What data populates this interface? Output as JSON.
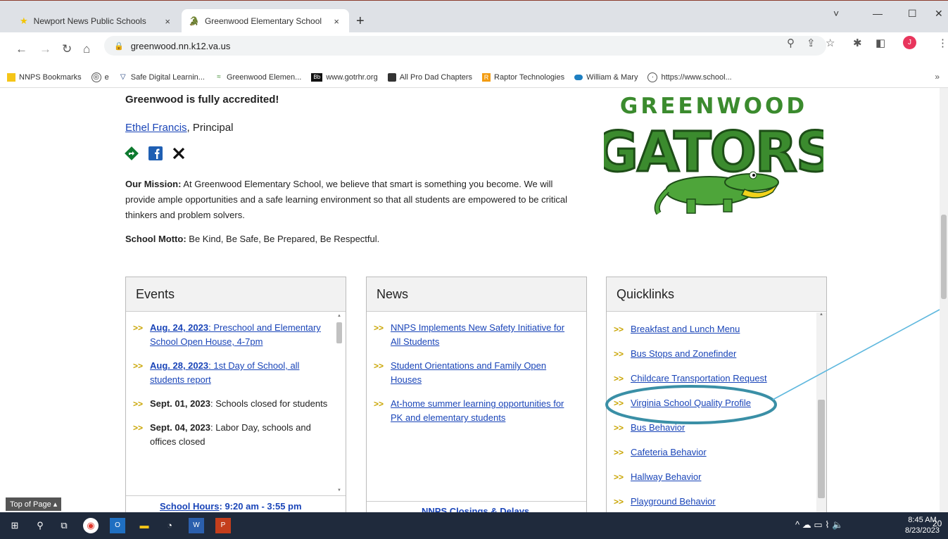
{
  "browser": {
    "tabs": [
      {
        "title": "Newport News Public Schools",
        "close": "×"
      },
      {
        "title": "Greenwood Elementary School",
        "close": "×"
      }
    ],
    "new_tab": "+",
    "window_controls": {
      "dropdown": "˅",
      "minimize": "—",
      "maximize": "☐",
      "close": "✕"
    },
    "url": "greenwood.nn.k12.va.us",
    "profile_initial": "J",
    "bookmarks": [
      {
        "label": "NNPS Bookmarks",
        "icon": "folder-icon"
      },
      {
        "label": "e",
        "icon": "edge-icon"
      },
      {
        "label": "Safe Digital Learnin...",
        "icon": "shield-icon"
      },
      {
        "label": "Greenwood Elemen...",
        "icon": "gator-icon"
      },
      {
        "label": "www.gotrhr.org",
        "icon": "bb-icon"
      },
      {
        "label": "All Pro Dad Chapters",
        "icon": "app-icon"
      },
      {
        "label": "Raptor Technologies",
        "icon": "raptor-icon"
      },
      {
        "label": "William & Mary",
        "icon": "wm-icon"
      },
      {
        "label": "https://www.school...",
        "icon": "globe-icon"
      }
    ],
    "bookmarks_more": "»"
  },
  "page": {
    "accredited": "Greenwood is fully accredited!",
    "principal_name": "Ethel Francis",
    "principal_title": ", Principal",
    "mission_label": "Our Mission:",
    "mission_text": " At Greenwood Elementary School, we believe that smart is something you become. We will provide ample opportunities and a safe learning environment so that all students are empowered to be critical thinkers and problem solvers.",
    "motto_label": "School Motto:",
    "motto_text": " Be Kind, Be Safe, Be Prepared, Be Respectful.",
    "logo_top": "GREENWOOD",
    "logo_main": "GATORS",
    "events": {
      "title": "Events",
      "items": [
        {
          "date": "Aug. 24, 2023",
          "text": ": Preschool and Elementary School Open House, 4-7pm",
          "linked": true
        },
        {
          "date": "Aug. 28, 2023",
          "text": ": 1st Day of School, all students report",
          "linked": true
        },
        {
          "date": "Sept. 01, 2023",
          "text": ": Schools closed for students",
          "linked": false
        },
        {
          "date": "Sept. 04, 2023",
          "text": ": Labor Day, schools and offices closed",
          "linked": false
        }
      ],
      "hours_label": "School Hours",
      "hours_text": ": 9:20 am - 3:55 pm"
    },
    "news": {
      "title": "News",
      "items": [
        "NNPS Implements New Safety Initiative for All Students",
        "Student Orientations and Family Open Houses",
        "At-home summer learning opportunities for PK and elementary students"
      ],
      "footer": "NNPS Closings & Delays"
    },
    "quicklinks": {
      "title": "Quicklinks",
      "items": [
        "Breakfast and Lunch Menu",
        "Bus Stops and Zonefinder",
        "Childcare Transportation Request",
        "Virginia School Quality Profile",
        "Bus Behavior",
        "Cafeteria Behavior",
        "Hallway Behavior",
        "Playground Behavior"
      ]
    },
    "top_of_page": "Top of Page ▴"
  },
  "taskbar": {
    "time": "8:45 AM",
    "date": "8/23/2023",
    "notifications": "20"
  },
  "colors": {
    "accent_link": "#1a45b8",
    "gator_green": "#3b8b2e",
    "annotation": "#3a8fa6"
  }
}
